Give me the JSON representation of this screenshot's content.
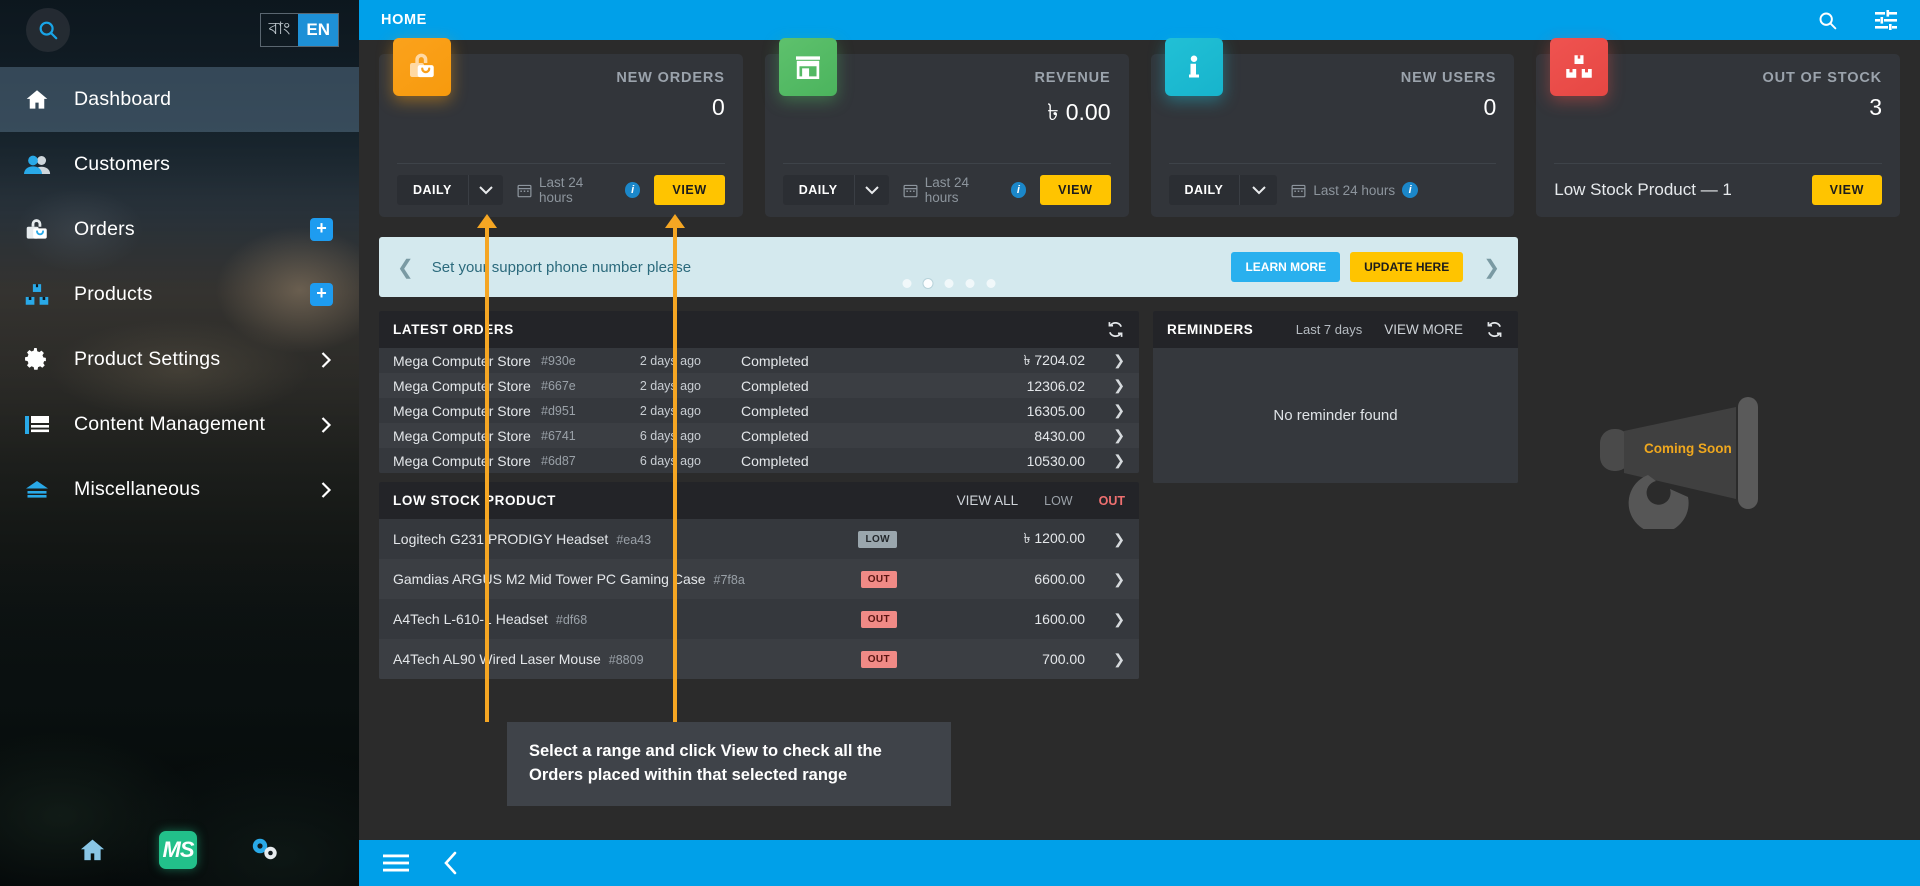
{
  "sidebar": {
    "search_icon": "search-icon",
    "language": {
      "options": [
        {
          "label": "বাং",
          "active": false
        },
        {
          "label": "EN",
          "active": true
        }
      ]
    },
    "items": [
      {
        "label": "Dashboard",
        "icon": "home-icon",
        "active": true,
        "badge": "",
        "chevron": false
      },
      {
        "label": "Customers",
        "icon": "users-icon",
        "active": false,
        "badge": "",
        "chevron": false
      },
      {
        "label": "Orders",
        "icon": "bag-icon",
        "active": false,
        "badge": "+",
        "chevron": false
      },
      {
        "label": "Products",
        "icon": "boxes-icon",
        "active": false,
        "badge": "+",
        "chevron": false
      },
      {
        "label": "Product Settings",
        "icon": "gear-icon",
        "active": false,
        "badge": "",
        "chevron": true
      },
      {
        "label": "Content Management",
        "icon": "content-icon",
        "active": false,
        "badge": "",
        "chevron": true
      },
      {
        "label": "Miscellaneous",
        "icon": "misc-icon",
        "active": false,
        "badge": "",
        "chevron": true
      }
    ],
    "footer": {
      "home_icon": "home-icon",
      "logo_text": "MS",
      "settings_icon": "gears-icon"
    }
  },
  "topbar": {
    "title": "HOME",
    "search_icon": "search-icon",
    "filter_icon": "filter-list-icon"
  },
  "cards": [
    {
      "icon": "shopping-bag-icon",
      "color": "#f9a01b",
      "title": "NEW ORDERS",
      "currency": "",
      "value": "0",
      "range_select": "DAILY",
      "range_label": "Last 24 hours",
      "info": "i",
      "view_label": "VIEW",
      "has_view": true
    },
    {
      "icon": "store-icon",
      "color": "#55b964",
      "title": "REVENUE",
      "currency": "৳",
      "value": "0.00",
      "range_select": "DAILY",
      "range_label": "Last 24 hours",
      "info": "i",
      "view_label": "VIEW",
      "has_view": true
    },
    {
      "icon": "info-icon",
      "color": "#1dbdd2",
      "title": "NEW USERS",
      "currency": "",
      "value": "0",
      "range_select": "DAILY",
      "range_label": "Last 24 hours",
      "info": "i",
      "view_label": "",
      "has_view": false
    },
    {
      "icon": "stock-boxes-icon",
      "color": "#ea4b47",
      "title": "OUT OF STOCK",
      "currency": "",
      "value": "3",
      "low_stock_label": "Low Stock Product — 1",
      "view_label": "VIEW",
      "has_view": true
    }
  ],
  "banner": {
    "prev_icon": "chevron-left-icon",
    "next_icon": "chevron-right-icon",
    "text": "Set your support phone number please",
    "learn_more_label": "LEARN MORE",
    "update_here_label": "UPDATE HERE",
    "dots_count": 5,
    "active_dot": 1
  },
  "latest_orders": {
    "title": "LATEST ORDERS",
    "refresh_icon": "refresh-icon",
    "rows": [
      {
        "name": "Mega Computer Store",
        "id": "#930e",
        "time": "2 days ago",
        "status": "Completed",
        "currency": "৳",
        "amount": "7204.02"
      },
      {
        "name": "Mega Computer Store",
        "id": "#667e",
        "time": "2 days ago",
        "status": "Completed",
        "currency": "",
        "amount": "12306.02"
      },
      {
        "name": "Mega Computer Store",
        "id": "#d951",
        "time": "2 days ago",
        "status": "Completed",
        "currency": "",
        "amount": "16305.00"
      },
      {
        "name": "Mega Computer Store",
        "id": "#6741",
        "time": "6 days ago",
        "status": "Completed",
        "currency": "",
        "amount": "8430.00"
      },
      {
        "name": "Mega Computer Store",
        "id": "#6d87",
        "time": "6 days ago",
        "status": "Completed",
        "currency": "",
        "amount": "10530.00"
      }
    ]
  },
  "low_stock": {
    "title": "LOW STOCK PRODUCT",
    "view_all_label": "VIEW ALL",
    "low_label": "LOW",
    "out_label": "OUT",
    "rows": [
      {
        "name": "Logitech G231 PRODIGY Headset",
        "id": "#ea43",
        "badge": "LOW",
        "badge_type": "low",
        "currency": "৳",
        "amount": "1200.00"
      },
      {
        "name": "Gamdias ARGUS M2 Mid Tower PC Gaming Case",
        "id": "#7f8a",
        "badge": "OUT",
        "badge_type": "out",
        "currency": "",
        "amount": "6600.00"
      },
      {
        "name": "A4Tech L-610-1 Headset",
        "id": "#df68",
        "badge": "OUT",
        "badge_type": "out",
        "currency": "",
        "amount": "1600.00"
      },
      {
        "name": "A4Tech AL90 Wired Laser Mouse",
        "id": "#8809",
        "badge": "OUT",
        "badge_type": "out",
        "currency": "",
        "amount": "700.00"
      }
    ]
  },
  "reminders": {
    "title": "REMINDERS",
    "range": "Last 7 days",
    "view_more_label": "VIEW MORE",
    "refresh_icon": "refresh-icon",
    "empty_text": "No reminder found"
  },
  "coming_soon": {
    "label": "Coming Soon",
    "icon": "megaphone-icon"
  },
  "callout": {
    "text": "Select a range and click View to check all the Orders placed within that selected range",
    "accent": "#f5a623"
  },
  "bottombar": {
    "menu_icon": "hamburger-menu-icon",
    "back_icon": "chevron-left-icon"
  }
}
